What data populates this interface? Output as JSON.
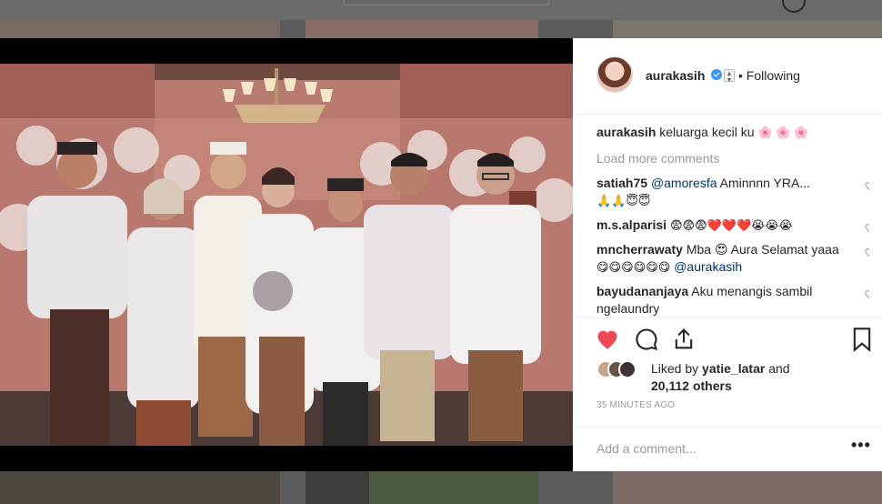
{
  "post": {
    "username": "aurakasih",
    "follow_state": "• Following",
    "caption_user": "aurakasih",
    "caption_text": "keluarga kecil ku",
    "caption_emoji": "🌸 🌸 🌸",
    "load_more": "Load more comments",
    "comments": [
      {
        "user": "satiah75",
        "mention": "@amoresfa",
        "text": "Aminnnn YRA...",
        "emoji": "🙏🙏😇😇"
      },
      {
        "user": "m.s.alparisi",
        "mention": "",
        "text": "",
        "emoji": "😨😨😨❤️❤️❤️😭😭😭"
      },
      {
        "user": "mncherrawaty",
        "mention": "",
        "text": "Mba 😍 Aura Selamat yaaa",
        "emoji": "😋😋😋😋😋😋",
        "mention_after": "@aurakasih"
      },
      {
        "user": "bayudananjaya",
        "mention": "",
        "text": "Aku menangis sambil ngelaundry",
        "emoji": ""
      }
    ],
    "likes_prefix": "Liked by",
    "likes_user": "yatie_latar",
    "likes_and": "and",
    "likes_count": "20,112 others",
    "timestamp": "35 MINUTES AGO",
    "add_comment_placeholder": "Add a comment...",
    "more_options": "•••"
  },
  "icons": {
    "like": "heart-filled-icon",
    "comment": "comment-bubble-icon",
    "share": "share-icon",
    "save": "bookmark-icon"
  },
  "colors": {
    "like_red": "#ed4956",
    "verified_blue": "#3897f0",
    "muted_text": "#999999",
    "link_text": "#003569"
  }
}
